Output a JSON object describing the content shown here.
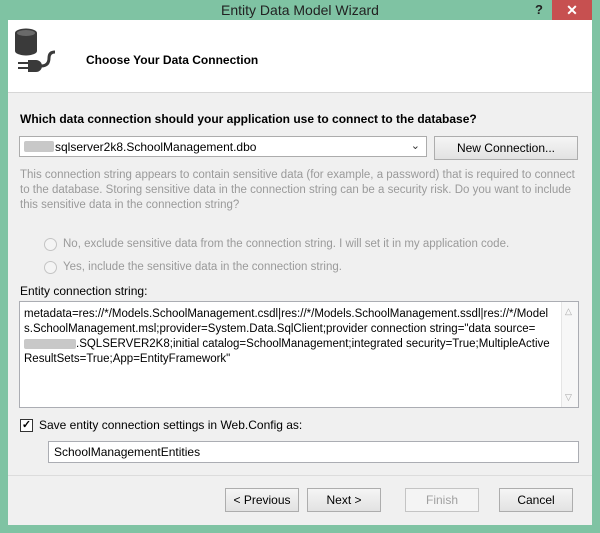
{
  "window": {
    "title": "Entity Data Model Wizard",
    "help_glyph": "?",
    "close_glyph": "✕"
  },
  "header": {
    "title": "Choose Your Data Connection",
    "icon": "database-connection-icon"
  },
  "question": "Which data connection should your application use to connect to the database?",
  "connection": {
    "selected": "sqlserver2k8.SchoolManagement.dbo",
    "new_button": "New Connection..."
  },
  "warning": "This connection string appears to contain sensitive data (for example, a password) that is required to connect to the database. Storing sensitive data in the connection string can be a security risk. Do you want to include this sensitive data in the connection string?",
  "radios": {
    "exclude": "No, exclude sensitive data from the connection string. I will set it in my application code.",
    "include": "Yes, include the sensitive data in the connection string."
  },
  "entity": {
    "label": "Entity connection string:",
    "string_part1": "metadata=res://*/Models.SchoolManagement.csdl|res://*/Models.SchoolManagement.ssdl|res://*/Models.SchoolManagement.msl;provider=System.Data.SqlClient;provider connection string=\"data source=",
    "string_part2": ".SQLSERVER2K8;initial catalog=SchoolManagement;integrated security=True;MultipleActiveResultSets=True;App=EntityFramework\""
  },
  "save": {
    "checked": true,
    "label": "Save entity connection settings in Web.Config as:",
    "value": "SchoolManagementEntities"
  },
  "buttons": {
    "previous": "< Previous",
    "next": "Next >",
    "finish": "Finish",
    "cancel": "Cancel"
  },
  "colors": {
    "title_bar": "#7fc3a3",
    "close_button": "#c75050",
    "dialog_bg": "#f0f0f0"
  }
}
